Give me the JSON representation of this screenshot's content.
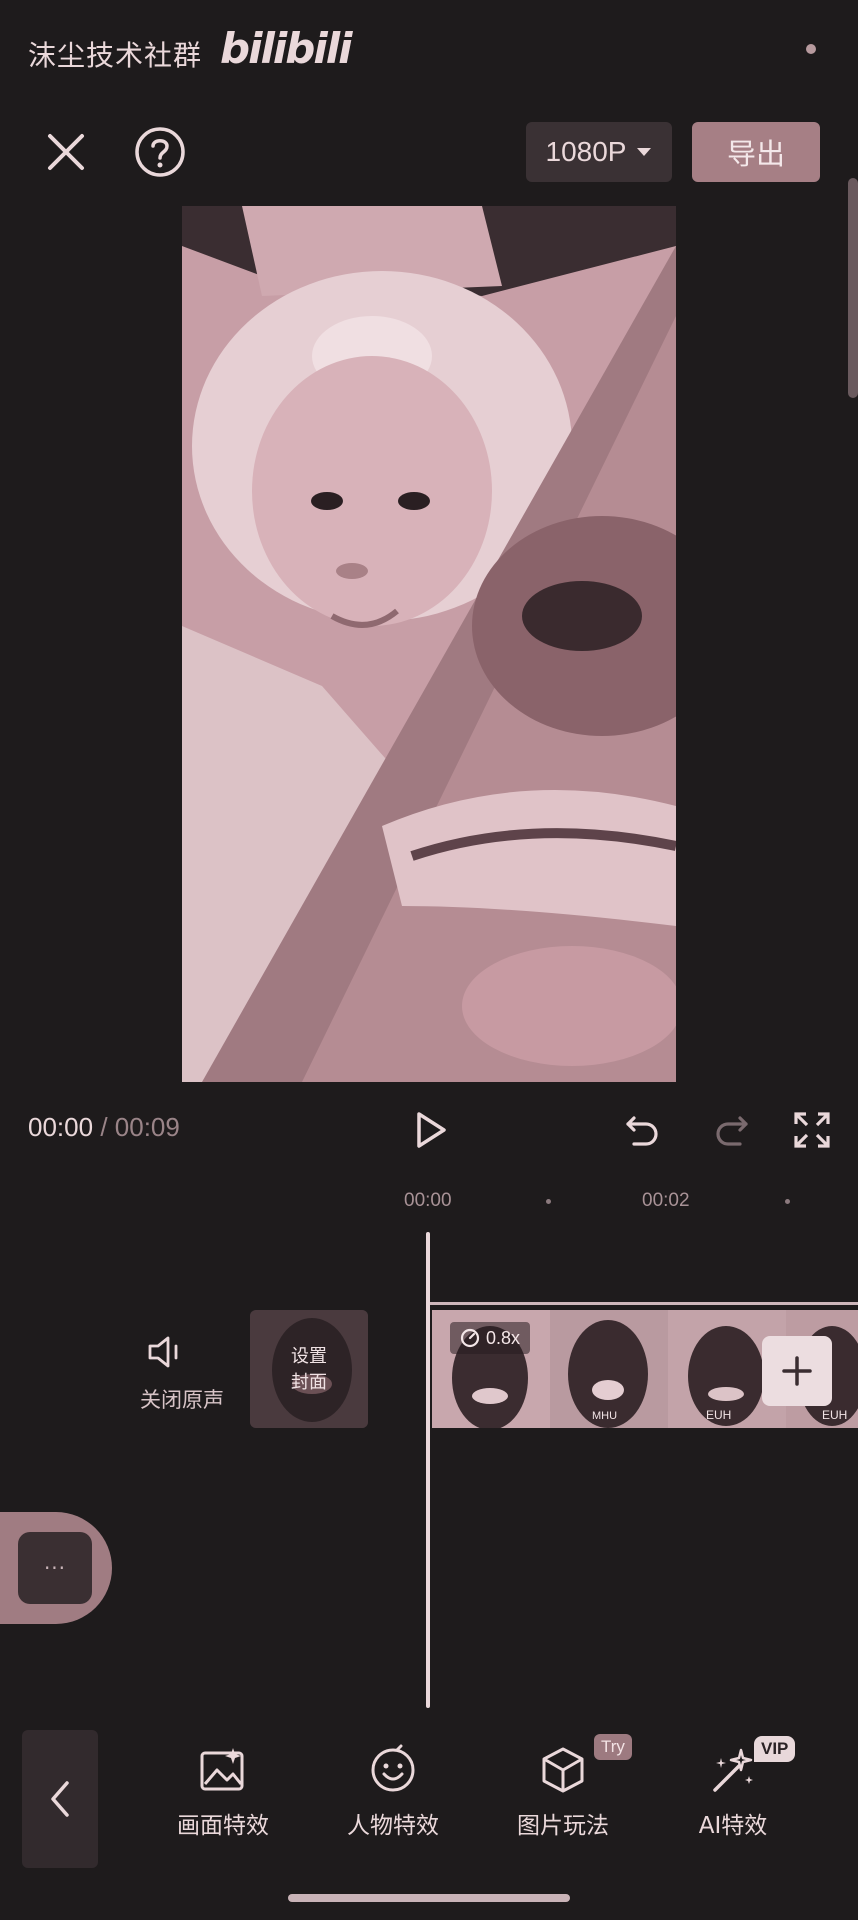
{
  "watermark": {
    "channel": "沫尘技术社群",
    "logo": "bilibili"
  },
  "topbar": {
    "close_icon": "close-icon",
    "help_icon": "help-icon",
    "resolution": "1080P",
    "export_label": "导出"
  },
  "playback": {
    "current_time": "00:00",
    "separator": "/",
    "total_time": "00:09"
  },
  "ruler": {
    "marks": [
      "00:00",
      "00:02"
    ]
  },
  "track": {
    "mute_label": "关闭原声",
    "cover_label_line1": "设置",
    "cover_label_line2": "封面",
    "speed": "0.8x",
    "frame_captions": [
      "MHU",
      "EUH",
      "EUH"
    ]
  },
  "side_handle": {
    "label": "···"
  },
  "toolbar": {
    "items": [
      {
        "label": "画面特效",
        "icon": "image-sparkle-icon"
      },
      {
        "label": "人物特效",
        "icon": "face-icon"
      },
      {
        "label": "图片玩法",
        "icon": "cube-icon",
        "badge": "Try"
      },
      {
        "label": "AI特效",
        "icon": "magic-wand-icon",
        "badge": "VIP"
      }
    ]
  },
  "colors": {
    "accent": "#a67f85",
    "background": "#1e1b1c",
    "text": "#ead8da"
  }
}
